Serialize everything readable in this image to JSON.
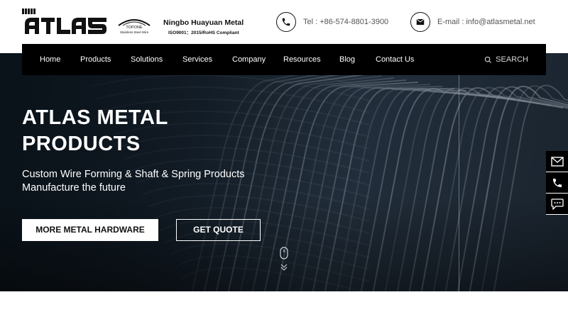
{
  "brand": {
    "logo_text": "ATLAS",
    "sub_logo": "TOPONE",
    "sub_logo_caption": "Stainless Steel Wire",
    "company_name": "Ningbo Huayuan Metal",
    "company_cert": "ISO9001：2015/RoHS Compliant"
  },
  "contact": {
    "tel": "Tel : +86-574-8801-3900",
    "email": "E-mail : info@atlasmetal.net"
  },
  "nav": {
    "items": [
      "Home",
      "Products",
      "Solutions",
      "Services",
      "Company",
      "Resources",
      "Blog",
      "Contact Us"
    ],
    "search_label": "SEARCH"
  },
  "hero": {
    "title_line1": "ATLAS METAL",
    "title_line2": "PRODUCTS",
    "subtitle_line1": "Custom Wire Forming & Shaft & Spring Products",
    "subtitle_line2": "Manufacture the future",
    "primary_button": "MORE METAL HARDWARE",
    "secondary_button": "GET QUOTE"
  },
  "side_float": [
    "mail-icon",
    "phone-icon",
    "chat-icon"
  ],
  "colors": {
    "nav_bg": "#000000",
    "hero_dark": "#1a2531",
    "button_bg": "#ffffff",
    "text_muted": "#555555"
  }
}
